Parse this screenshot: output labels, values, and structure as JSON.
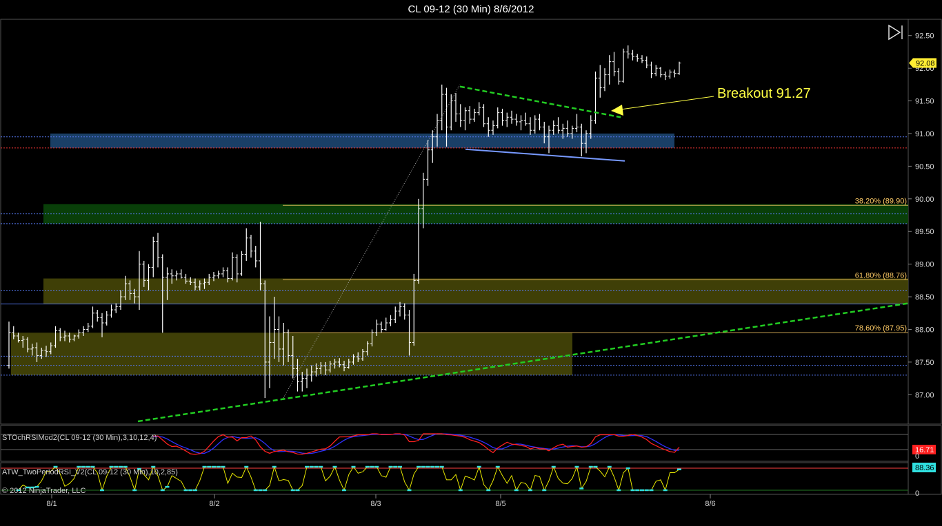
{
  "window": {
    "title": "CL 09-12 (30 Min)  8/6/2012",
    "copyright": "© 2012 NinjaTrader, LLC"
  },
  "colors": {
    "background": "#000000",
    "price_bar": "#ffffff",
    "trendline_green": "#22cc22",
    "support_blue": "#7799ff",
    "annotation_yellow": "#ffff44",
    "zone_blue": "#1e4a78",
    "zone_green": "#0b4a0b",
    "zone_olive": "#4a4a08",
    "stoch_red": "#ff2020",
    "stoch_blue": "#3030ff",
    "rsi_yellow": "#e8e800",
    "rsi_cyan": "#30e0e0"
  },
  "chart_data": {
    "type": "candlestick",
    "instrument": "CL 09-12",
    "interval": "30 Min",
    "x_tick_labels": [
      "8/1",
      "8/2",
      "8/3",
      "8/5",
      "8/6"
    ],
    "y_axis": {
      "ylim": [
        86.55,
        92.75
      ],
      "ticks": [
        87.0,
        87.5,
        88.0,
        88.5,
        89.0,
        89.5,
        90.0,
        90.5,
        91.0,
        91.5,
        92.0,
        92.5
      ],
      "tick_labels": [
        "87.00",
        "87.50",
        "88.00",
        "88.50",
        "89.00",
        "89.50",
        "90.00",
        "90.50",
        "91.00",
        "91.50",
        "92.00",
        "92.50"
      ]
    },
    "last_price_label": "92.08",
    "fib_levels": [
      {
        "label": "38.20% (89.90)",
        "price": 89.9,
        "color": "#ffcc66"
      },
      {
        "label": "61.80% (88.76)",
        "price": 88.76,
        "color": "#ffcc66"
      },
      {
        "label": "78.60% (87.95)",
        "price": 87.95,
        "color": "#ffcc66"
      }
    ],
    "horizontal_lines": [
      {
        "price": 90.95,
        "color": "#5577ee",
        "style": "dotted"
      },
      {
        "price": 90.78,
        "color": "#ee3333",
        "style": "dotted"
      },
      {
        "price": 89.77,
        "color": "#5577ee",
        "style": "dotted"
      },
      {
        "price": 89.62,
        "color": "#5577ee",
        "style": "dotted"
      },
      {
        "price": 88.6,
        "color": "#5577ee",
        "style": "dotted"
      },
      {
        "price": 88.39,
        "color": "#5577ee",
        "style": "solid"
      },
      {
        "price": 87.59,
        "color": "#5577ee",
        "style": "dotted"
      },
      {
        "price": 87.45,
        "color": "#5577ee",
        "style": "dotted"
      },
      {
        "price": 87.3,
        "color": "#5577ee",
        "style": "dotted"
      }
    ],
    "zones": [
      {
        "x_from": "8/1",
        "x_to": "8/5",
        "price_low": 90.78,
        "price_high": 91.0,
        "color": "blue"
      },
      {
        "x_from": "8/1",
        "x_to": "8/6",
        "price_low": 89.62,
        "price_high": 89.92,
        "color": "green"
      },
      {
        "x_from": "8/1",
        "x_to": "8/6",
        "price_low": 88.39,
        "price_high": 88.78,
        "color": "olive"
      },
      {
        "x_from": "8/1",
        "x_to": "8/5",
        "price_low": 87.3,
        "price_high": 87.95,
        "color": "olive"
      }
    ],
    "annotation": {
      "text": "Breakout 91.27",
      "price": 91.27
    },
    "ohlc": [
      {
        "o": 87.45,
        "h": 88.12,
        "l": 87.4,
        "c": 87.95
      },
      {
        "o": 87.95,
        "h": 88.05,
        "l": 87.85,
        "c": 87.9
      },
      {
        "o": 87.9,
        "h": 87.95,
        "l": 87.8,
        "c": 87.83
      },
      {
        "o": 87.83,
        "h": 87.9,
        "l": 87.72,
        "c": 87.85
      },
      {
        "o": 87.85,
        "h": 87.88,
        "l": 87.65,
        "c": 87.7
      },
      {
        "o": 87.7,
        "h": 87.78,
        "l": 87.6,
        "c": 87.72
      },
      {
        "o": 87.72,
        "h": 87.8,
        "l": 87.5,
        "c": 87.6
      },
      {
        "o": 87.6,
        "h": 87.72,
        "l": 87.55,
        "c": 87.68
      },
      {
        "o": 87.68,
        "h": 87.75,
        "l": 87.58,
        "c": 87.66
      },
      {
        "o": 87.66,
        "h": 87.8,
        "l": 87.62,
        "c": 87.75
      },
      {
        "o": 87.75,
        "h": 88.05,
        "l": 87.72,
        "c": 87.98
      },
      {
        "o": 87.98,
        "h": 88.02,
        "l": 87.82,
        "c": 87.88
      },
      {
        "o": 87.88,
        "h": 87.98,
        "l": 87.82,
        "c": 87.9
      },
      {
        "o": 87.9,
        "h": 87.95,
        "l": 87.8,
        "c": 87.85
      },
      {
        "o": 87.85,
        "h": 87.92,
        "l": 87.82,
        "c": 87.9
      },
      {
        "o": 87.9,
        "h": 88.0,
        "l": 87.86,
        "c": 87.95
      },
      {
        "o": 87.95,
        "h": 88.05,
        "l": 87.9,
        "c": 88.0
      },
      {
        "o": 88.0,
        "h": 88.1,
        "l": 87.96,
        "c": 88.05
      },
      {
        "o": 88.05,
        "h": 88.35,
        "l": 88.02,
        "c": 88.25
      },
      {
        "o": 88.25,
        "h": 88.3,
        "l": 88.12,
        "c": 88.18
      },
      {
        "o": 88.18,
        "h": 88.25,
        "l": 87.88,
        "c": 88.1
      },
      {
        "o": 88.1,
        "h": 88.28,
        "l": 88.06,
        "c": 88.22
      },
      {
        "o": 88.22,
        "h": 88.38,
        "l": 88.18,
        "c": 88.3
      },
      {
        "o": 88.3,
        "h": 88.4,
        "l": 88.25,
        "c": 88.35
      },
      {
        "o": 88.35,
        "h": 88.6,
        "l": 88.3,
        "c": 88.5
      },
      {
        "o": 88.5,
        "h": 88.82,
        "l": 88.45,
        "c": 88.7
      },
      {
        "o": 88.7,
        "h": 88.75,
        "l": 88.45,
        "c": 88.55
      },
      {
        "o": 88.55,
        "h": 88.62,
        "l": 88.4,
        "c": 88.5
      },
      {
        "o": 88.5,
        "h": 89.2,
        "l": 88.3,
        "c": 89.0
      },
      {
        "o": 89.0,
        "h": 89.05,
        "l": 88.65,
        "c": 88.75
      },
      {
        "o": 88.75,
        "h": 89.0,
        "l": 88.6,
        "c": 88.95
      },
      {
        "o": 88.95,
        "h": 89.42,
        "l": 88.8,
        "c": 89.35
      },
      {
        "o": 89.35,
        "h": 89.48,
        "l": 88.95,
        "c": 89.1
      },
      {
        "o": 89.1,
        "h": 89.15,
        "l": 87.95,
        "c": 88.8
      },
      {
        "o": 88.8,
        "h": 88.95,
        "l": 88.45,
        "c": 88.85
      },
      {
        "o": 88.85,
        "h": 88.92,
        "l": 88.7,
        "c": 88.82
      },
      {
        "o": 88.82,
        "h": 88.9,
        "l": 88.75,
        "c": 88.85
      },
      {
        "o": 88.85,
        "h": 88.92,
        "l": 88.78,
        "c": 88.8
      },
      {
        "o": 88.8,
        "h": 88.85,
        "l": 88.7,
        "c": 88.74
      },
      {
        "o": 88.74,
        "h": 88.8,
        "l": 88.68,
        "c": 88.72
      },
      {
        "o": 88.72,
        "h": 88.78,
        "l": 88.6,
        "c": 88.65
      },
      {
        "o": 88.65,
        "h": 88.75,
        "l": 88.6,
        "c": 88.7
      },
      {
        "o": 88.7,
        "h": 88.78,
        "l": 88.62,
        "c": 88.72
      },
      {
        "o": 88.72,
        "h": 88.85,
        "l": 88.68,
        "c": 88.8
      },
      {
        "o": 88.8,
        "h": 88.88,
        "l": 88.74,
        "c": 88.82
      },
      {
        "o": 88.82,
        "h": 88.9,
        "l": 88.78,
        "c": 88.85
      },
      {
        "o": 88.85,
        "h": 88.95,
        "l": 88.8,
        "c": 88.9
      },
      {
        "o": 88.9,
        "h": 88.95,
        "l": 88.72,
        "c": 88.78
      },
      {
        "o": 88.78,
        "h": 89.18,
        "l": 88.75,
        "c": 89.1
      },
      {
        "o": 89.1,
        "h": 89.15,
        "l": 88.72,
        "c": 88.85
      },
      {
        "o": 88.85,
        "h": 89.2,
        "l": 88.82,
        "c": 89.15
      },
      {
        "o": 89.15,
        "h": 89.55,
        "l": 89.05,
        "c": 89.4
      },
      {
        "o": 89.4,
        "h": 89.45,
        "l": 89.1,
        "c": 89.2
      },
      {
        "o": 89.2,
        "h": 89.28,
        "l": 88.95,
        "c": 89.05
      },
      {
        "o": 89.05,
        "h": 89.65,
        "l": 88.6,
        "c": 88.7
      },
      {
        "o": 88.7,
        "h": 88.75,
        "l": 86.95,
        "c": 87.5
      },
      {
        "o": 87.5,
        "h": 88.2,
        "l": 87.1,
        "c": 87.8
      },
      {
        "o": 87.8,
        "h": 88.5,
        "l": 87.55,
        "c": 88.0
      },
      {
        "o": 88.0,
        "h": 88.2,
        "l": 87.5,
        "c": 87.7
      },
      {
        "o": 87.7,
        "h": 88.1,
        "l": 87.45,
        "c": 87.95
      },
      {
        "o": 87.95,
        "h": 88.0,
        "l": 87.5,
        "c": 87.6
      },
      {
        "o": 87.6,
        "h": 87.9,
        "l": 87.25,
        "c": 87.4
      },
      {
        "o": 87.4,
        "h": 87.55,
        "l": 87.05,
        "c": 87.2
      },
      {
        "o": 87.2,
        "h": 87.35,
        "l": 87.05,
        "c": 87.25
      },
      {
        "o": 87.25,
        "h": 87.4,
        "l": 87.1,
        "c": 87.3
      },
      {
        "o": 87.3,
        "h": 87.45,
        "l": 87.2,
        "c": 87.35
      },
      {
        "o": 87.35,
        "h": 87.48,
        "l": 87.28,
        "c": 87.4
      },
      {
        "o": 87.4,
        "h": 87.5,
        "l": 87.32,
        "c": 87.44
      },
      {
        "o": 87.44,
        "h": 87.5,
        "l": 87.3,
        "c": 87.38
      },
      {
        "o": 87.38,
        "h": 87.52,
        "l": 87.34,
        "c": 87.47
      },
      {
        "o": 87.47,
        "h": 87.55,
        "l": 87.4,
        "c": 87.5
      },
      {
        "o": 87.5,
        "h": 87.56,
        "l": 87.42,
        "c": 87.46
      },
      {
        "o": 87.46,
        "h": 87.52,
        "l": 87.36,
        "c": 87.42
      },
      {
        "o": 87.42,
        "h": 87.55,
        "l": 87.4,
        "c": 87.5
      },
      {
        "o": 87.5,
        "h": 87.62,
        "l": 87.46,
        "c": 87.58
      },
      {
        "o": 87.58,
        "h": 87.65,
        "l": 87.5,
        "c": 87.55
      },
      {
        "o": 87.55,
        "h": 87.7,
        "l": 87.52,
        "c": 87.66
      },
      {
        "o": 87.66,
        "h": 87.82,
        "l": 87.6,
        "c": 87.78
      },
      {
        "o": 87.78,
        "h": 88.0,
        "l": 87.74,
        "c": 87.95
      },
      {
        "o": 87.95,
        "h": 88.15,
        "l": 87.9,
        "c": 88.08
      },
      {
        "o": 88.08,
        "h": 88.12,
        "l": 87.95,
        "c": 88.0
      },
      {
        "o": 88.0,
        "h": 88.18,
        "l": 87.98,
        "c": 88.1
      },
      {
        "o": 88.1,
        "h": 88.22,
        "l": 88.05,
        "c": 88.15
      },
      {
        "o": 88.15,
        "h": 88.35,
        "l": 88.1,
        "c": 88.28
      },
      {
        "o": 88.28,
        "h": 88.42,
        "l": 88.2,
        "c": 88.35
      },
      {
        "o": 88.35,
        "h": 88.4,
        "l": 88.15,
        "c": 88.22
      },
      {
        "o": 88.22,
        "h": 88.3,
        "l": 87.6,
        "c": 87.8
      },
      {
        "o": 87.8,
        "h": 88.85,
        "l": 87.75,
        "c": 88.75
      },
      {
        "o": 88.75,
        "h": 90.0,
        "l": 88.7,
        "c": 89.85
      },
      {
        "o": 89.85,
        "h": 90.4,
        "l": 89.55,
        "c": 90.3
      },
      {
        "o": 90.3,
        "h": 90.9,
        "l": 90.2,
        "c": 90.75
      },
      {
        "o": 90.75,
        "h": 91.05,
        "l": 90.55,
        "c": 90.95
      },
      {
        "o": 90.95,
        "h": 91.3,
        "l": 90.8,
        "c": 91.2
      },
      {
        "o": 91.2,
        "h": 91.75,
        "l": 91.05,
        "c": 91.6
      },
      {
        "o": 91.6,
        "h": 91.7,
        "l": 90.8,
        "c": 91.1
      },
      {
        "o": 91.1,
        "h": 91.6,
        "l": 91.05,
        "c": 91.5
      },
      {
        "o": 91.5,
        "h": 91.62,
        "l": 91.18,
        "c": 91.3
      },
      {
        "o": 91.3,
        "h": 91.45,
        "l": 91.1,
        "c": 91.2
      },
      {
        "o": 91.2,
        "h": 91.4,
        "l": 91.05,
        "c": 91.35
      },
      {
        "o": 91.35,
        "h": 91.42,
        "l": 91.15,
        "c": 91.22
      },
      {
        "o": 91.22,
        "h": 91.38,
        "l": 91.18,
        "c": 91.32
      },
      {
        "o": 91.32,
        "h": 91.48,
        "l": 91.28,
        "c": 91.4
      },
      {
        "o": 91.4,
        "h": 91.45,
        "l": 91.1,
        "c": 91.15
      },
      {
        "o": 91.15,
        "h": 91.25,
        "l": 90.95,
        "c": 91.05
      },
      {
        "o": 91.05,
        "h": 91.2,
        "l": 90.98,
        "c": 91.12
      },
      {
        "o": 91.12,
        "h": 91.4,
        "l": 91.08,
        "c": 91.32
      },
      {
        "o": 91.32,
        "h": 91.38,
        "l": 91.12,
        "c": 91.2
      },
      {
        "o": 91.2,
        "h": 91.32,
        "l": 91.1,
        "c": 91.25
      },
      {
        "o": 91.25,
        "h": 91.35,
        "l": 91.15,
        "c": 91.22
      },
      {
        "o": 91.22,
        "h": 91.3,
        "l": 91.12,
        "c": 91.18
      },
      {
        "o": 91.18,
        "h": 91.28,
        "l": 91.05,
        "c": 91.2
      },
      {
        "o": 91.2,
        "h": 91.32,
        "l": 91.12,
        "c": 91.15
      },
      {
        "o": 91.15,
        "h": 91.25,
        "l": 90.98,
        "c": 91.05
      },
      {
        "o": 91.05,
        "h": 91.28,
        "l": 91.0,
        "c": 91.22
      },
      {
        "o": 91.22,
        "h": 91.3,
        "l": 91.05,
        "c": 91.1
      },
      {
        "o": 91.1,
        "h": 91.18,
        "l": 90.85,
        "c": 90.95
      },
      {
        "o": 90.95,
        "h": 91.12,
        "l": 90.7,
        "c": 91.05
      },
      {
        "o": 91.05,
        "h": 91.2,
        "l": 90.98,
        "c": 91.12
      },
      {
        "o": 91.12,
        "h": 91.25,
        "l": 91.0,
        "c": 91.05
      },
      {
        "o": 91.05,
        "h": 91.15,
        "l": 90.92,
        "c": 91.08
      },
      {
        "o": 91.08,
        "h": 91.2,
        "l": 90.95,
        "c": 91.0
      },
      {
        "o": 91.0,
        "h": 91.12,
        "l": 90.92,
        "c": 91.08
      },
      {
        "o": 91.08,
        "h": 91.3,
        "l": 91.02,
        "c": 91.1
      },
      {
        "o": 91.1,
        "h": 91.15,
        "l": 90.65,
        "c": 90.85
      },
      {
        "o": 90.85,
        "h": 91.05,
        "l": 90.7,
        "c": 91.0
      },
      {
        "o": 91.0,
        "h": 91.28,
        "l": 90.92,
        "c": 91.2
      },
      {
        "o": 91.2,
        "h": 91.95,
        "l": 91.15,
        "c": 91.85
      },
      {
        "o": 91.85,
        "h": 92.05,
        "l": 91.55,
        "c": 91.7
      },
      {
        "o": 91.7,
        "h": 92.0,
        "l": 91.65,
        "c": 91.9
      },
      {
        "o": 91.9,
        "h": 92.2,
        "l": 91.75,
        "c": 92.1
      },
      {
        "o": 92.1,
        "h": 92.25,
        "l": 91.88,
        "c": 91.95
      },
      {
        "o": 91.95,
        "h": 92.0,
        "l": 91.75,
        "c": 91.8
      },
      {
        "o": 91.8,
        "h": 92.3,
        "l": 91.78,
        "c": 92.25
      },
      {
        "o": 92.25,
        "h": 92.35,
        "l": 92.15,
        "c": 92.22
      },
      {
        "o": 92.22,
        "h": 92.28,
        "l": 92.12,
        "c": 92.18
      },
      {
        "o": 92.18,
        "h": 92.22,
        "l": 92.1,
        "c": 92.15
      },
      {
        "o": 92.15,
        "h": 92.2,
        "l": 92.08,
        "c": 92.12
      },
      {
        "o": 92.12,
        "h": 92.18,
        "l": 92.0,
        "c": 92.05
      },
      {
        "o": 92.05,
        "h": 92.1,
        "l": 91.85,
        "c": 91.92
      },
      {
        "o": 91.92,
        "h": 92.05,
        "l": 91.88,
        "c": 92.0
      },
      {
        "o": 92.0,
        "h": 92.02,
        "l": 91.86,
        "c": 91.9
      },
      {
        "o": 91.9,
        "h": 91.95,
        "l": 91.82,
        "c": 91.88
      },
      {
        "o": 91.88,
        "h": 91.98,
        "l": 91.84,
        "c": 91.94
      },
      {
        "o": 91.94,
        "h": 91.98,
        "l": 91.86,
        "c": 91.92
      },
      {
        "o": 91.92,
        "h": 92.1,
        "l": 91.9,
        "c": 92.08
      }
    ],
    "indicators": [
      {
        "name": "STOchRSIMod2(CL 09-12 (30 Min),3,10,12,4)",
        "value_labels": [
          "16.71"
        ],
        "axis_label": "0"
      },
      {
        "name": "ATW_TwoPeriodRSI_V2(CL 09-12 (30 Min),10,2,85)",
        "value_labels": [
          "88.36"
        ],
        "axis_label": "0"
      }
    ]
  }
}
